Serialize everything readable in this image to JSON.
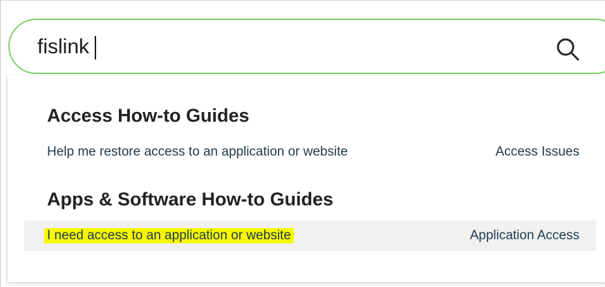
{
  "search": {
    "value": "fislink",
    "icon": "search-icon"
  },
  "results": {
    "groups": [
      {
        "heading": "Access How-to Guides",
        "items": [
          {
            "title": "Help me restore access to an application or website",
            "category": "Access Issues"
          }
        ]
      },
      {
        "heading": "Apps & Software How-to Guides",
        "items": [
          {
            "title": "I need access to an application or website",
            "category": "Application Access"
          }
        ]
      }
    ]
  },
  "colors": {
    "search_border": "#7ccf6c",
    "highlight": "#f7f700",
    "row_hover": "#f1f1f1",
    "link_text": "#1f3a4d"
  }
}
